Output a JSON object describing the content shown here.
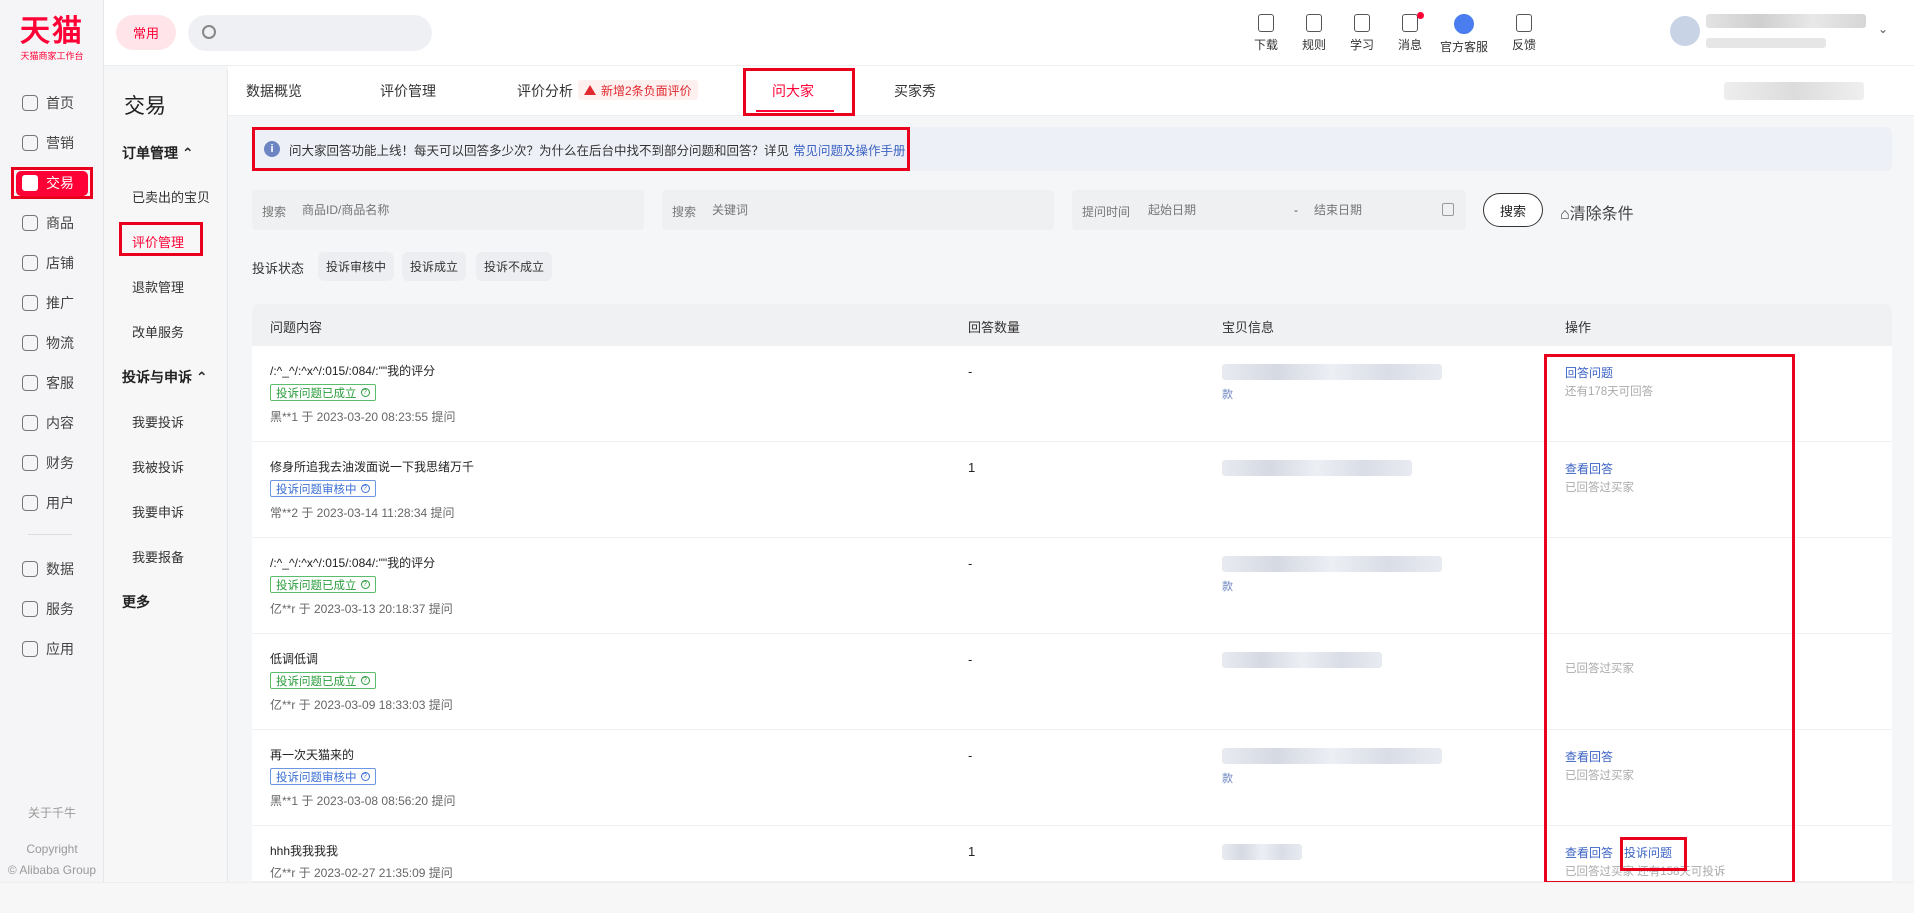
{
  "logo": {
    "main": "天猫",
    "sub": "天猫商家工作台"
  },
  "rail": {
    "items": [
      {
        "label": "首页",
        "icon": "home-icon"
      },
      {
        "label": "营销",
        "icon": "megaphone-icon"
      },
      {
        "label": "交易",
        "icon": "trade-icon"
      },
      {
        "label": "商品",
        "icon": "goods-icon"
      },
      {
        "label": "店铺",
        "icon": "store-icon"
      },
      {
        "label": "推广",
        "icon": "promote-icon"
      },
      {
        "label": "物流",
        "icon": "truck-icon"
      },
      {
        "label": "客服",
        "icon": "headset-icon"
      },
      {
        "label": "内容",
        "icon": "content-icon"
      },
      {
        "label": "财务",
        "icon": "finance-icon"
      },
      {
        "label": "用户",
        "icon": "user-icon"
      },
      {
        "label": "数据",
        "icon": "chart-icon"
      },
      {
        "label": "服务",
        "icon": "service-icon"
      },
      {
        "label": "应用",
        "icon": "app-icon"
      }
    ],
    "about": "关于千牛",
    "copyright": "Copyright",
    "company": "© Alibaba Group"
  },
  "side": {
    "title": "交易",
    "group1": "订单管理",
    "group1_items": [
      "已卖出的宝贝",
      "评价管理",
      "退款管理",
      "改单服务"
    ],
    "group2": "投诉与申诉",
    "group2_items": [
      "我要投诉",
      "我被投诉",
      "我要申诉",
      "我要报备"
    ],
    "more": "更多"
  },
  "topbar": {
    "common": "常用",
    "tools": [
      {
        "label": "下载",
        "icon": "download-icon"
      },
      {
        "label": "规则",
        "icon": "rules-icon"
      },
      {
        "label": "学习",
        "icon": "study-icon"
      },
      {
        "label": "消息",
        "icon": "message-icon"
      },
      {
        "label": "官方客服",
        "icon": "official-service-icon"
      },
      {
        "label": "反馈",
        "icon": "feedback-icon"
      }
    ]
  },
  "tabs": {
    "items": [
      "数据概览",
      "评价管理",
      "评价分析",
      "问大家",
      "买家秀"
    ],
    "negative_badge": "新增2条负面评价"
  },
  "notice": {
    "text": "问大家回答功能上线！每天可以回答多少次？为什么在后台中找不到部分问题和回答？详见",
    "link": "常见问题及操作手册"
  },
  "filters": {
    "search1_label": "搜索",
    "search1_placeholder": "商品ID/商品名称",
    "search2_label": "搜索",
    "search2_placeholder": "关键词",
    "time_label": "提问时间",
    "start_placeholder": "起始日期",
    "dash": "-",
    "end_placeholder": "结束日期",
    "search_button": "搜索",
    "clear_button": "⌂清除条件"
  },
  "status": {
    "label": "投诉状态",
    "chips": [
      "投诉审核中",
      "投诉成立",
      "投诉不成立"
    ]
  },
  "table": {
    "headers": [
      "问题内容",
      "回答数量",
      "宝贝信息",
      "操作"
    ],
    "rows": [
      {
        "question": "/:^_^/:^x^/:015/:084/:\"\"我的评分",
        "tag": "投诉问题已成立",
        "who": "黑**1 于 2023-03-20 08:23:55 提问",
        "count": "-",
        "prod_suffix": "款",
        "action": "回答问题",
        "action2": "",
        "sub": "还有178天可回答"
      },
      {
        "question": "修身所追我去油泼面说一下我思绪万千",
        "tag": "投诉问题审核中",
        "who": "常**2 于 2023-03-14 11:28:34 提问",
        "count": "1",
        "prod_suffix": "",
        "action": "查看回答",
        "action2": "",
        "sub": "已回答过买家"
      },
      {
        "question": "/:^_^/:^x^/:015/:084/:\"\"我的评分",
        "tag": "投诉问题已成立",
        "who": "亿**r 于 2023-03-13 20:18:37 提问",
        "count": "-",
        "prod_suffix": "款",
        "action": "",
        "action2": "",
        "sub": ""
      },
      {
        "question": "低调低调",
        "tag": "投诉问题已成立",
        "who": "亿**r 于 2023-03-09 18:33:03 提问",
        "count": "-",
        "prod_suffix": "",
        "action": "",
        "action2": "",
        "sub": "已回答过买家"
      },
      {
        "question": "再一次天猫来的",
        "tag": "投诉问题审核中",
        "who": "黑**1 于 2023-03-08 08:56:20 提问",
        "count": "-",
        "prod_suffix": "款",
        "action": "查看回答",
        "action2": "",
        "sub": "已回答过买家"
      },
      {
        "question": "hhh我我我我",
        "tag": "",
        "who": "亿**r 于 2023-02-27 21:35:09 提问",
        "count": "1",
        "prod_suffix": "",
        "action": "查看回答",
        "action2": "投诉问题",
        "sub": "已回答过买家   还有158天可投诉"
      }
    ]
  },
  "colors": {
    "brand": "#ff0036",
    "link": "#3c63c4",
    "highlight": "#e8001c"
  }
}
